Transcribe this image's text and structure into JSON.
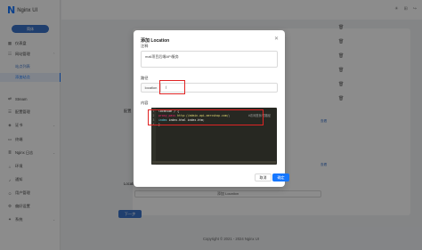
{
  "app": {
    "logo_mark": "N",
    "logo_text": "Nginx UI",
    "lang_button": "简体"
  },
  "sidebar": {
    "items": [
      {
        "label": "仪表盘",
        "icon": "dashboard-icon",
        "glyph": "▦"
      },
      {
        "label": "网站管理",
        "icon": "sites-icon",
        "glyph": "☷",
        "arrow": "⌃"
      },
      {
        "label": "站点列表"
      },
      {
        "label": "添加站点"
      },
      {
        "label": "Stream",
        "icon": "stream-icon",
        "glyph": "⇄"
      },
      {
        "label": "配置管理",
        "icon": "config-icon",
        "glyph": "☰"
      },
      {
        "label": "证书",
        "icon": "certificate-icon",
        "glyph": "◈",
        "arrow": "⌄"
      },
      {
        "label": "终端",
        "icon": "terminal-icon",
        "glyph": "▭"
      },
      {
        "label": "Nginx 日志",
        "icon": "log-icon",
        "glyph": "≣",
        "arrow": "⌄"
      },
      {
        "label": "环境",
        "icon": "environment-icon",
        "glyph": "⌂"
      },
      {
        "label": "通知",
        "icon": "bell-icon",
        "glyph": "♪"
      },
      {
        "label": "用户管理",
        "icon": "user-icon",
        "glyph": "☺"
      },
      {
        "label": "偏好设置",
        "icon": "settings-icon",
        "glyph": "⚙"
      },
      {
        "label": "系统",
        "icon": "system-icon",
        "glyph": "✦",
        "arrow": "⌄"
      }
    ]
  },
  "topbar": {
    "icons": [
      "☀",
      "⊞",
      "↪"
    ]
  },
  "background": {
    "label_1": "配置",
    "label_2": "Location",
    "link_text": "查看",
    "add_location": "添加 Location",
    "next_button": "下一步",
    "footer": "Copyright © 2021 - 2024 Nginx UI"
  },
  "modal": {
    "title": "添加 Location",
    "comment_label": "注释",
    "comment_value": "mall项目后端API服务",
    "path_label": "路径",
    "path_addon": "location",
    "path_value": "/",
    "content_label": "内容",
    "code_lines": [
      {
        "n": "1",
        "parts": [
          [
            "",
            "location / {"
          ]
        ]
      },
      {
        "n": "2",
        "parts": [
          [
            "k1",
            "    proxy_pass"
          ],
          [
            "k3",
            "  http://admin-api.mercshop.com/"
          ],
          [
            "",
            ";"
          ]
        ]
      },
      {
        "n": "3",
        "parts": [
          [
            "k2",
            "    index"
          ],
          [
            "",
            "  index.html index.htm;"
          ]
        ]
      },
      {
        "n": "4",
        "parts": [
          [
            "",
            "}"
          ]
        ]
      }
    ],
    "hint": "#访问首页/根路径",
    "cancel_button": "取消",
    "ok_button": "确定",
    "close_icon": "close-icon"
  }
}
